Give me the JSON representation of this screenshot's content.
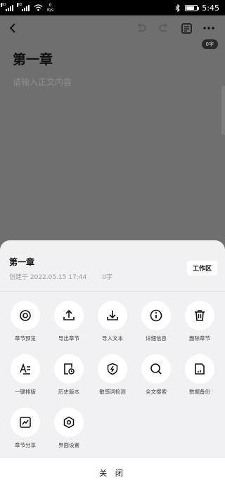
{
  "status_bar": {
    "sim1": "HD",
    "sim2": "HD",
    "net_speed_value": "0",
    "net_speed_unit": "K/s",
    "clock": "5:45",
    "battery_level": 0.8
  },
  "editor": {
    "word_count": "0字",
    "title": "第一章",
    "placeholder": "请输入正文内容"
  },
  "sheet": {
    "title": "第一章",
    "created": "创建于 2022.05.15 17:44",
    "word_count": "0字",
    "workspace_label": "工作区",
    "close_label": "关 闭"
  },
  "actions": [
    {
      "label": "章节预览",
      "icon": "eye-icon"
    },
    {
      "label": "导出章节",
      "icon": "export-icon"
    },
    {
      "label": "导入文本",
      "icon": "import-icon"
    },
    {
      "label": "详细信息",
      "icon": "info-icon"
    },
    {
      "label": "删除章节",
      "icon": "trash-icon"
    },
    {
      "label": "一键排版",
      "icon": "typeset-icon"
    },
    {
      "label": "历史版本",
      "icon": "history-icon"
    },
    {
      "label": "敏感词检测",
      "icon": "sensitive-check-icon"
    },
    {
      "label": "全文搜索",
      "icon": "search-icon"
    },
    {
      "label": "数据备份",
      "icon": "backup-icon"
    },
    {
      "label": "章节分享",
      "icon": "share-chart-icon"
    },
    {
      "label": "界面设置",
      "icon": "settings-icon"
    }
  ]
}
